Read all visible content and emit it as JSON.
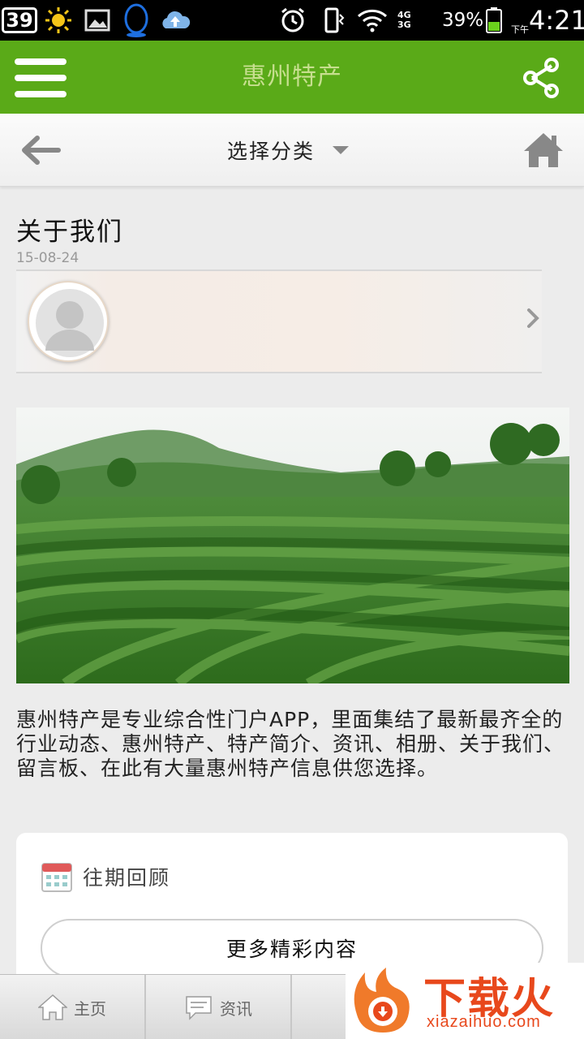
{
  "status_bar": {
    "notification_count": "39",
    "network_4g": "4G",
    "network_3g": "3G",
    "battery_percent": "39%",
    "ampm": "下午",
    "time": "4:21",
    "icons": [
      "sun-icon",
      "gallery-icon",
      "qq-icon",
      "cloud-upload-icon",
      "alarm-icon",
      "vibrate-icon",
      "wifi-icon",
      "signal-icon",
      "battery-icon"
    ]
  },
  "header": {
    "title": "惠州特产",
    "brand_color": "#5aaa18",
    "title_color": "#c7df8f"
  },
  "subnav": {
    "category_label": "选择分类"
  },
  "article": {
    "title": "关于我们",
    "date": "15-08-24",
    "body": "惠州特产是专业综合性门户APP，里面集结了最新最齐全的行业动态、惠州特产、特产简介、资讯、相册、关于我们、留言板、在此有大量惠州特产信息供您选择。"
  },
  "history": {
    "label": "往期回顾",
    "more_button": "更多精彩内容"
  },
  "tabs": [
    {
      "label": "主页",
      "icon": "home-icon"
    },
    {
      "label": "资讯",
      "icon": "chat-icon"
    },
    {
      "label": "",
      "icon": "cart-icon"
    },
    {
      "label": "",
      "icon": "tab-icon"
    }
  ],
  "watermark": {
    "brand": "下载火",
    "domain": "xiazaihuo.com"
  }
}
